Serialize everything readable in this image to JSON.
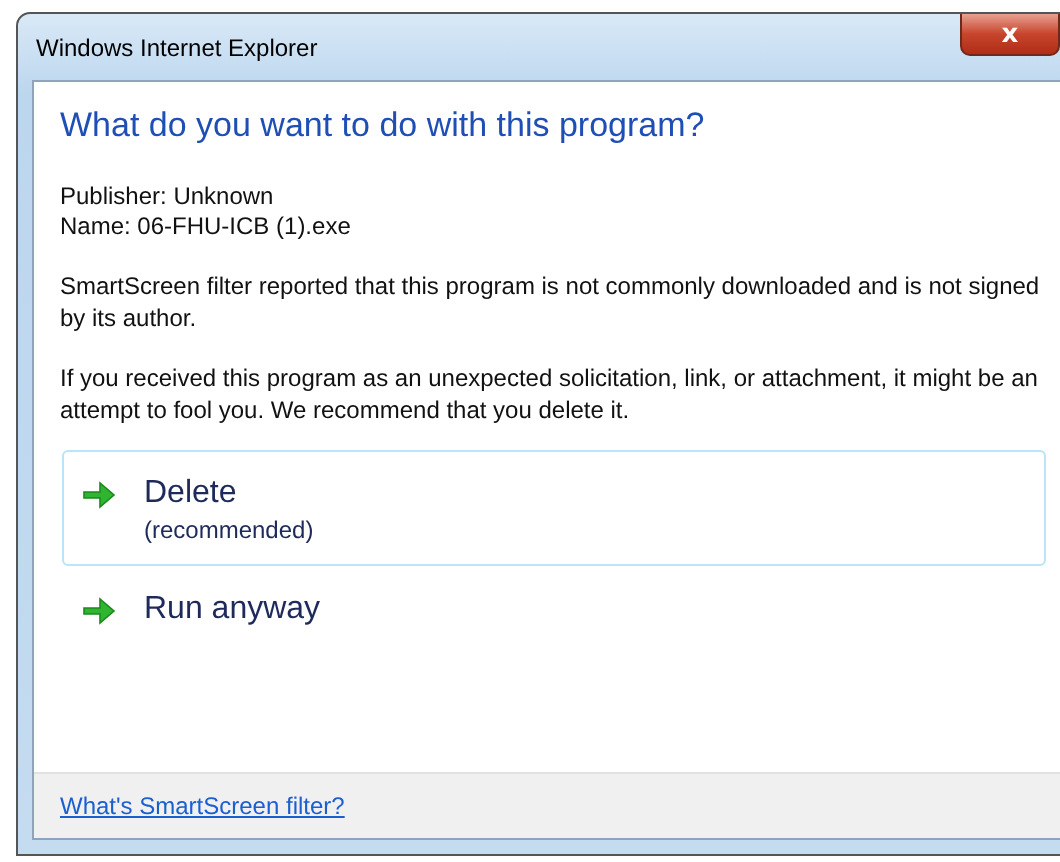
{
  "window": {
    "title": "Windows Internet Explorer",
    "close": "x"
  },
  "heading": "What do you want to do with this program?",
  "details": [
    "Publisher: Unknown",
    "Name: 06-FHU-ICB (1).exe"
  ],
  "paragraphs": [
    "SmartScreen filter reported that this program is not commonly downloaded and is not signed by its author.",
    "If you received this program as an unexpected solicitation, link, or attachment, it might be an attempt to fool you. We recommend that you delete it."
  ],
  "options": [
    {
      "label": "Delete",
      "note": "(recommended)",
      "selected": true
    },
    {
      "label": "Run anyway",
      "selected": false
    }
  ],
  "footer_link": "What's SmartScreen filter?"
}
